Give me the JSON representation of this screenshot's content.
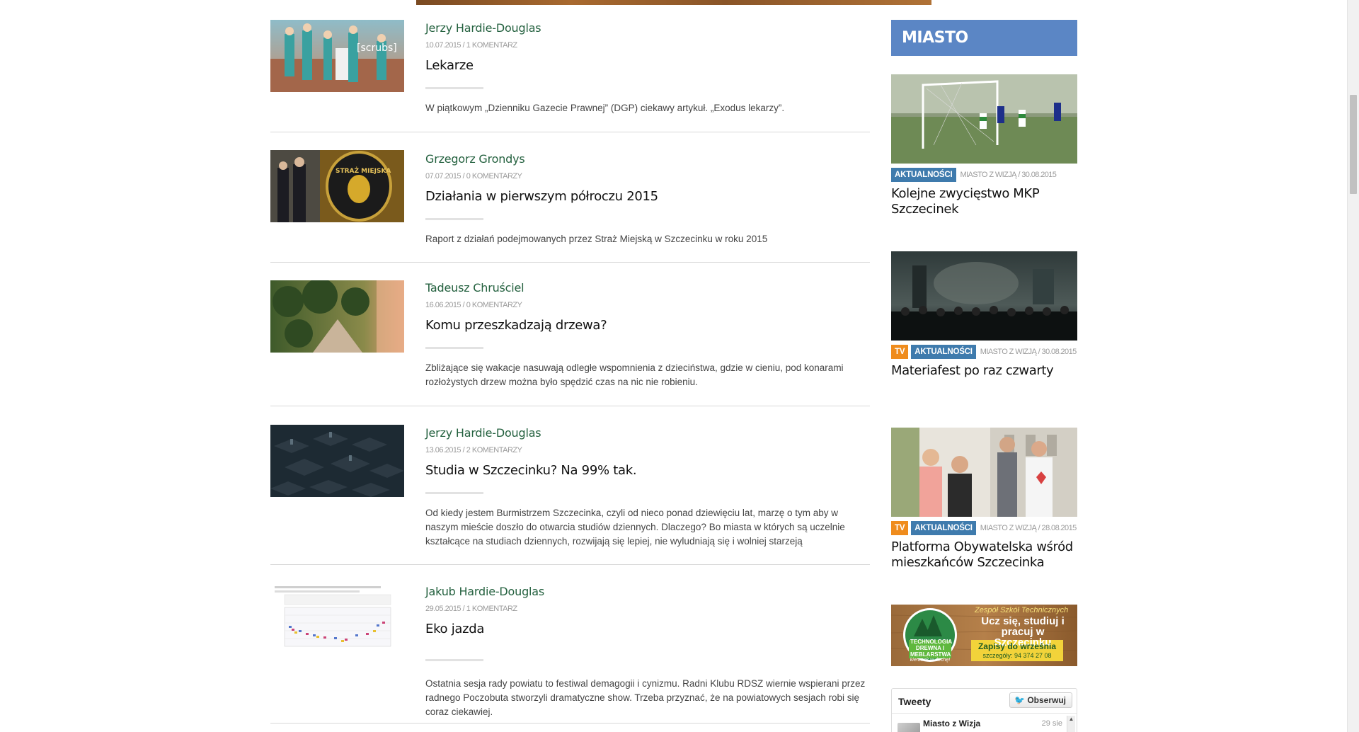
{
  "articles": [
    {
      "author": "Jerzy Hardie-Douglas",
      "meta": "10.07.2015 / 1 KOMENTARZ",
      "title": "Lekarze",
      "excerpt": "W piątkowym „Dzienniku Gazecie Prawnej” (DGP) ciekawy artykuł. „Exodus lekarzy”.",
      "thumb_text": "[scrubs]"
    },
    {
      "author": "Grzegorz Grondys",
      "meta": "07.07.2015 / 0 KOMENTARZY",
      "title": "Działania w pierwszym półroczu 2015",
      "excerpt": "Raport z działań podejmowanych przez Straż Miejską w Szczecinku w roku 2015",
      "thumb_text": "STRAŻ MIEJSKA"
    },
    {
      "author": "Tadeusz Chruściel",
      "meta": "16.06.2015 / 0 KOMENTARZY",
      "title": "Komu przeszkadzają drzewa?",
      "excerpt": "Zbliżające się wakacje nasuwają odległe wspomnienia z dzieciństwa, gdzie w cieniu, pod konarami rozłożystych drzew można było spędzić czas na nic nie robieniu."
    },
    {
      "author": "Jerzy Hardie-Douglas",
      "meta": "13.06.2015 / 2 KOMENTARZY",
      "title": "Studia w Szczecinku? Na 99% tak.",
      "excerpt": "Od kiedy jestem Burmistrzem Szczecinka, czyli od nieco ponad dziewięciu lat, marzę o tym aby w naszym mieście doszło do otwarcia studiów dziennych. Dlaczego? Bo miasta w których są uczelnie kształcące na studiach dziennych, rozwijają się lepiej, nie wyludniają się i wolniej starzeją"
    },
    {
      "author": "Jakub Hardie-Douglas",
      "meta": "29.05.2015 / 1 KOMENTARZ",
      "title": "Eko jazda",
      "excerpt": "Ostatnia sesja rady powiatu to festiwal demagogii i cynizmu. Radni Klubu RDSZ wiernie wspierani przez radnego Poczobuta stworzyli dramatyczne show. Trzeba przyznać, że na powiatowych sesjach robi się coraz ciekawiej."
    }
  ],
  "sidebar": {
    "header": "MIASTO",
    "items": [
      {
        "tags": [
          "AKTUALNOŚCI"
        ],
        "meta": "MIASTO Z WIZJĄ / 30.08.2015",
        "title": "Kolejne zwycięstwo MKP Szczecinek"
      },
      {
        "tags": [
          "TV",
          "AKTUALNOŚCI"
        ],
        "meta": "MIASTO Z WIZJĄ / 30.08.2015",
        "title": "Materiafest po raz czwarty"
      },
      {
        "tags": [
          "TV",
          "AKTUALNOŚCI"
        ],
        "meta": "MIASTO Z WIZJĄ / 28.08.2015",
        "title": "Platforma Obywatelska wśród mieszkańców Szczecinka"
      }
    ],
    "ad": {
      "school": "Zespół Szkół Technicznych",
      "slogan": "Ucz się, studiuj i pracuj w Szczecinku",
      "badge": "TECHNOLOGIA DREWNA I MEBLARSTWA",
      "badge_sub": "kierunek w dechę!",
      "enroll": "Zapisy do września",
      "phone": "szczegóły: 94 374 27 08"
    },
    "tweets": {
      "title": "Tweety",
      "follow": "Obserwuj",
      "name": "Miasto z Wizja",
      "time": "29 sie"
    }
  },
  "colors": {
    "accent_green": "#24613f",
    "sidebar_header": "#5b86c5",
    "tag_tv": "#ef8c1d",
    "tag_news": "#3f7bad"
  }
}
